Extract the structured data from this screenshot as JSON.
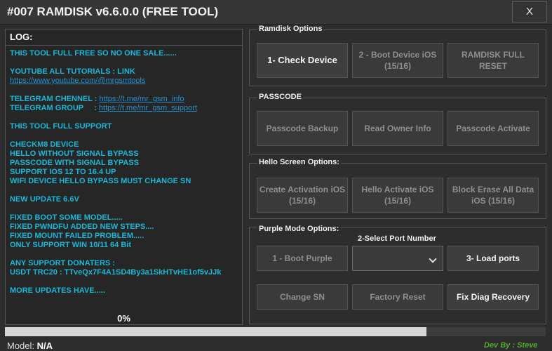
{
  "window": {
    "title": "#007 RAMDISK v6.6.0.0 (FREE TOOL)",
    "close_label": "X"
  },
  "log": {
    "header": "LOG:",
    "line1": "THIS TOOL FULL FREE SO NO ONE SALE......",
    "yt_label": "YOUTUBE ALL TUTORIALS : LINK ",
    "yt_link": "https://www.youtube.com/@mrgsmtools",
    "tg_channel_label": "TELEGRAM CHENNEL : ",
    "tg_channel_link": "https://t.me/mr_gsm_info",
    "tg_group_label": "TELEGRAM GROUP     : ",
    "tg_group_link": "https://t.me/mr_gsm_support",
    "support_head": " THIS TOOL FULL SUPPORT ",
    "f1": " CHECKM8 DEVICE ",
    "f2": " HELLO WITHOUT SIGNAL BYPASS",
    "f3": " PASSCODE WITH SIGNAL BYPASS",
    "f4": " SUPPORT IOS 12 TO 16.4 UP",
    "f5": " WIFI DEVICE HELLO BYPASS MUST CHANGE SN",
    "update": " NEW UPDATE 6.6V ",
    "u1": "FIXED BOOT SOME MODEL.....",
    "u2": "FIXED PWNDFU ADDED NEW STEPS....",
    "u3": "FIXED MOUNT FAILED PROBLEM.....",
    "u4": "ONLY SUPPORT WIN 10/11 64 Bit",
    "donaters": "ANY SUPPORT DONATERS :",
    "usdt": "USDT TRC20 : TTveQx7F4A1SD4By3a1SkHTvHE1of5vJJk",
    "more": "MORE UPDATES HAVE.....",
    "percent": "0%"
  },
  "ramdisk": {
    "title": "Ramdisk Options",
    "check": "1- Check Device",
    "boot": "2 - Boot Device iOS (15/16)",
    "full": "RAMDISK FULL RESET"
  },
  "passcode": {
    "title": "PASSCODE",
    "backup": "Passcode Backup",
    "owner": "Read Owner Info",
    "activate": "Passcode Activate"
  },
  "hello": {
    "title": "Hello Screen Options:",
    "create": "Create Activation iOS (15/16)",
    "activate": "Hello Activate iOS (15/16)",
    "erase": "Block Erase All Data iOS (15/16)"
  },
  "purple": {
    "title": "Purple Mode Options:",
    "port_label": "2-Select Port Number",
    "port_value": "",
    "boot": "1 - Boot Purple",
    "load": "3- Load ports",
    "change_sn": "Change SN",
    "factory": "Factory Reset",
    "fix_diag": "Fix Diag Recovery"
  },
  "progress": {
    "value": 0.78
  },
  "status": {
    "model_label": "Model: ",
    "model_value": "N/A",
    "dev": "Dev By : Steve"
  },
  "colors": {
    "log_text": "#19b8d8",
    "link": "#2a8fc8",
    "dev": "#4caf2a",
    "bg": "#2d2d2d"
  }
}
